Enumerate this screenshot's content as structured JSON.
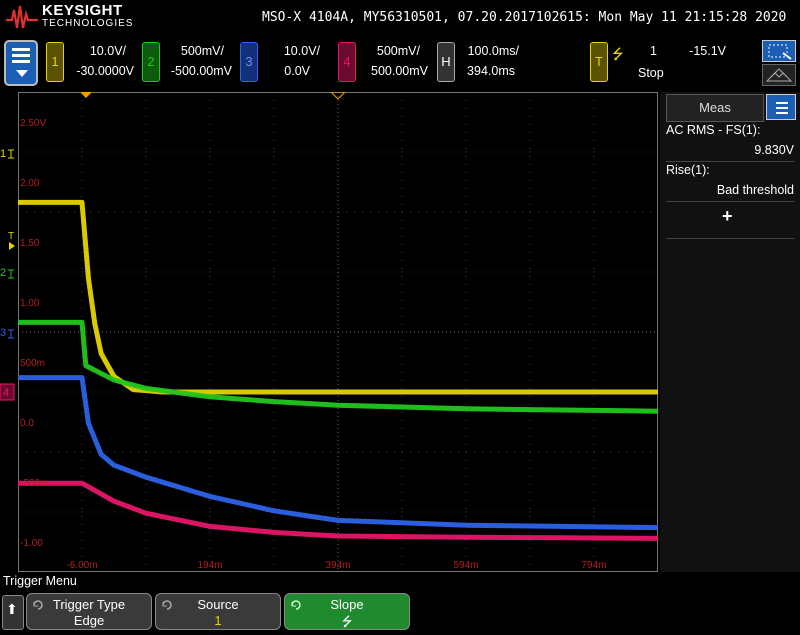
{
  "brand": {
    "name": "KEYSIGHT",
    "sub": "TECHNOLOGIES"
  },
  "title_line": "MSO-X 4104A, MY56310501, 07.20.2017102615: Mon May 11 21:15:28 2020",
  "channels": [
    {
      "num": "1",
      "scale": "10.0V/",
      "offset": "-30.0000V",
      "color": "#e6d400"
    },
    {
      "num": "2",
      "scale": "500mV/",
      "offset": "-500.00mV",
      "color": "#22c81e"
    },
    {
      "num": "3",
      "scale": "10.0V/",
      "offset": "0.0V",
      "color": "#2c63e8"
    },
    {
      "num": "4",
      "scale": "500mV/",
      "offset": "500.00mV",
      "color": "#e8156b"
    }
  ],
  "horizontal": {
    "label": "H",
    "scale": "100.0ms/",
    "delay": "394.0ms"
  },
  "trigger": {
    "label": "T",
    "edge_glyph": "⭍",
    "source": "1",
    "level": "-15.1V",
    "state": "Stop"
  },
  "y_labels": [
    "2.50V",
    "2.00",
    "1.50",
    "1.00",
    "500m",
    "0.0",
    "-500m",
    "-1.00"
  ],
  "x_labels": [
    "-6.00m",
    "194m",
    "394m",
    "594m",
    "794m"
  ],
  "meas": {
    "tab": "Meas",
    "m1_name": "AC RMS - FS(1):",
    "m1_value": "9.830V",
    "m2_name": "Rise(1):",
    "m2_value": "Bad threshold",
    "add": "+"
  },
  "menu": {
    "title": "Trigger Menu",
    "keys": [
      {
        "top": "Trigger Type",
        "bottom": "Edge"
      },
      {
        "top": "Source",
        "bottom": "1"
      },
      {
        "top": "Slope",
        "bottom": "⭍"
      }
    ]
  },
  "chart_data": {
    "type": "line",
    "title": "",
    "xlabel": "",
    "ylabel": "",
    "xlim_ms": [
      -106,
      894
    ],
    "series": [
      {
        "name": "1",
        "color": "#e6d400",
        "x": [
          -106,
          -6,
          4,
          14,
          24,
          44,
          74,
          120,
          300,
          894
        ],
        "y": [
          1.83,
          1.83,
          1.2,
          0.82,
          0.57,
          0.38,
          0.27,
          0.25,
          0.25,
          0.25
        ]
      },
      {
        "name": "2",
        "color": "#22c81e",
        "x": [
          -106,
          -6,
          0,
          44,
          94,
          194,
          294,
          394,
          594,
          894
        ],
        "y": [
          0.83,
          0.83,
          0.47,
          0.35,
          0.28,
          0.21,
          0.17,
          0.14,
          0.11,
          0.09
        ]
      },
      {
        "name": "3",
        "color": "#2c63e8",
        "x": [
          -106,
          -6,
          4,
          24,
          44,
          94,
          194,
          294,
          394,
          594,
          894
        ],
        "y": [
          0.37,
          0.37,
          -0.01,
          -0.27,
          -0.36,
          -0.46,
          -0.62,
          -0.74,
          -0.82,
          -0.86,
          -0.88
        ]
      },
      {
        "name": "4",
        "color": "#e8156b",
        "x": [
          -106,
          -6,
          44,
          94,
          194,
          294,
          394,
          594,
          894
        ],
        "y": [
          -0.51,
          -0.51,
          -0.66,
          -0.76,
          -0.87,
          -0.92,
          -0.95,
          -0.96,
          -0.97
        ]
      }
    ]
  }
}
